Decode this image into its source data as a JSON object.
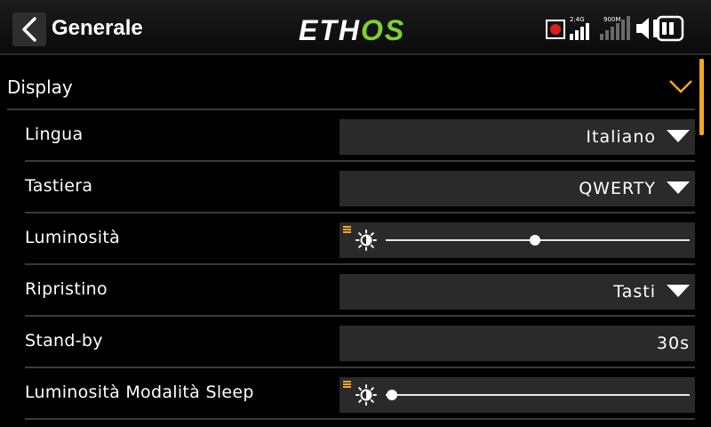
{
  "header": {
    "title": "Generale",
    "logo_left": "ETH",
    "logo_right": "OS",
    "signal_24_label": "2.4G",
    "signal_900_label": "900M"
  },
  "colors": {
    "accent": "#f5a623",
    "logo_green": "#7fd12f",
    "field_bg": "#2a2a2a",
    "record": "#e01b1b"
  },
  "section": {
    "title": "Display",
    "expanded": true
  },
  "rows": [
    {
      "label": "Lingua",
      "type": "dropdown",
      "value": "Italiano"
    },
    {
      "label": "Tastiera",
      "type": "dropdown",
      "value": "QWERTY"
    },
    {
      "label": "Luminosità",
      "type": "slider",
      "level": 0.49
    },
    {
      "label": "Ripristino",
      "type": "dropdown",
      "value": "Tasti"
    },
    {
      "label": "Stand-by",
      "type": "number",
      "value": "30s"
    },
    {
      "label": "Luminosità Modalità Sleep",
      "type": "slider",
      "level": 0.02
    }
  ]
}
